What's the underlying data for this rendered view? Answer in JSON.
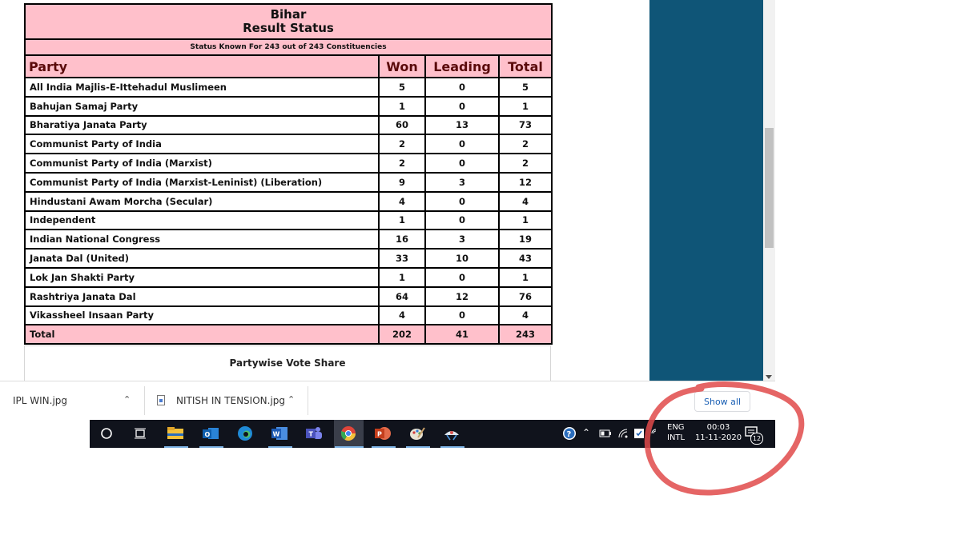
{
  "table": {
    "state": "Bihar",
    "title": "Result Status",
    "status_line": "Status Known For 243 out of 243 Constituencies",
    "columns": [
      "Party",
      "Won",
      "Leading",
      "Total"
    ],
    "rows": [
      {
        "party": "All India Majlis-E-Ittehadul Muslimeen",
        "won": "5",
        "leading": "0",
        "total": "5"
      },
      {
        "party": "Bahujan Samaj Party",
        "won": "1",
        "leading": "0",
        "total": "1"
      },
      {
        "party": "Bharatiya Janata Party",
        "won": "60",
        "leading": "13",
        "total": "73"
      },
      {
        "party": "Communist Party of India",
        "won": "2",
        "leading": "0",
        "total": "2"
      },
      {
        "party": "Communist Party of India (Marxist)",
        "won": "2",
        "leading": "0",
        "total": "2"
      },
      {
        "party": "Communist Party of India (Marxist-Leninist) (Liberation)",
        "won": "9",
        "leading": "3",
        "total": "12"
      },
      {
        "party": "Hindustani Awam Morcha (Secular)",
        "won": "4",
        "leading": "0",
        "total": "4"
      },
      {
        "party": "Independent",
        "won": "1",
        "leading": "0",
        "total": "1"
      },
      {
        "party": "Indian National Congress",
        "won": "16",
        "leading": "3",
        "total": "19"
      },
      {
        "party": "Janata Dal (United)",
        "won": "33",
        "leading": "10",
        "total": "43"
      },
      {
        "party": "Lok Jan Shakti Party",
        "won": "1",
        "leading": "0",
        "total": "1"
      },
      {
        "party": "Rashtriya Janata Dal",
        "won": "64",
        "leading": "12",
        "total": "76"
      },
      {
        "party": "Vikassheel Insaan Party",
        "won": "4",
        "leading": "0",
        "total": "4"
      }
    ],
    "total_row": {
      "party": "Total",
      "won": "202",
      "leading": "41",
      "total": "243"
    }
  },
  "vote_share_heading": "Partywise Vote Share",
  "downloads": {
    "items": [
      {
        "name": "IPL WIN.jpg"
      },
      {
        "name": "NITISH IN TENSION.jpg"
      }
    ],
    "show_all_label": "Show all"
  },
  "taskbar": {
    "apps": [
      "search-icon",
      "task-view-icon",
      "file-explorer-icon",
      "outlook-icon",
      "edge-icon",
      "word-icon",
      "teams-icon",
      "chrome-icon",
      "powerpoint-icon",
      "paint-icon",
      "snipping-icon"
    ],
    "language_top": "ENG",
    "language_bottom": "INTL",
    "time": "00:03",
    "date": "11-11-2020",
    "notification_count": "12"
  },
  "colors": {
    "table_header_bg": "#ffc0cb",
    "side_panel": "#0f5577",
    "taskbar_bg": "#10131c",
    "annotation_red": "#e04a4a"
  }
}
